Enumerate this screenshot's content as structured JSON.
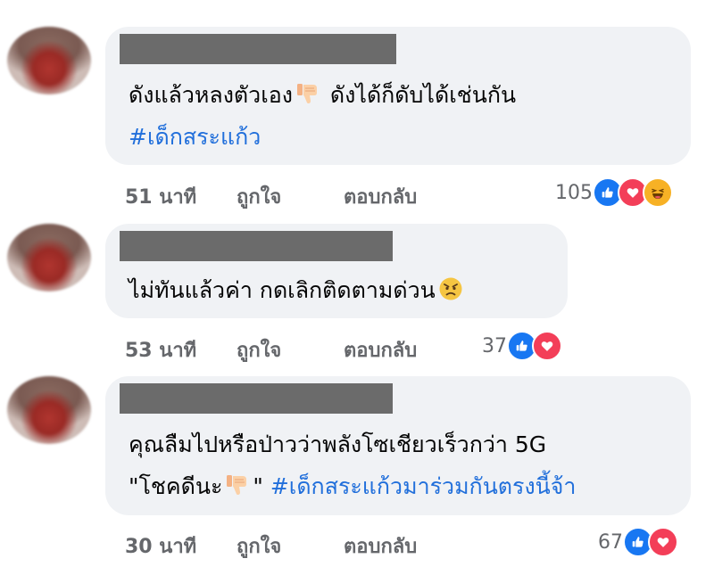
{
  "comments": [
    {
      "lines": [
        {
          "text": "ดังแล้วหลงตัวเอง",
          "emoji": "thumbs-down-icon",
          "after": "ดังได้ก็ดับได้เช่นกัน"
        },
        {
          "hashtag": "#เด็กสระแก้ว"
        }
      ],
      "time": "51 นาที",
      "like": "ถูกใจ",
      "reply": "ตอบกลับ",
      "reaction_count": "105",
      "reactions": [
        "like-icon",
        "love-icon",
        "haha-icon"
      ]
    },
    {
      "lines": [
        {
          "text": "ไม่ทันแล้วค่า กดเลิกติดตามด่วน",
          "emoji": "angry-face-icon"
        }
      ],
      "time": "53 นาที",
      "like": "ถูกใจ",
      "reply": "ตอบกลับ",
      "reaction_count": "37",
      "reactions": [
        "like-icon",
        "love-icon"
      ]
    },
    {
      "lines": [
        {
          "text": "คุณลืมไปหรือป่าวว่าพลังโซเชียวเร็วกว่า 5G"
        },
        {
          "text": "\"โชคดีนะ",
          "emoji": "thumbs-down-icon",
          "after": "\"",
          "hashtag": "#เด็กสระแก้วมาร่วมกันตรงนี้จ้า"
        }
      ],
      "time": "30 นาที",
      "like": "ถูกใจ",
      "reply": "ตอบกลับ",
      "reaction_count": "67",
      "reactions": [
        "like-icon",
        "love-icon"
      ]
    }
  ],
  "colors": {
    "bubble": "#f0f2f5",
    "hashtag": "#216fdb",
    "meta": "#65676b",
    "like": "#1877f2",
    "love": "#f33e58",
    "haha": "#f7b125"
  }
}
